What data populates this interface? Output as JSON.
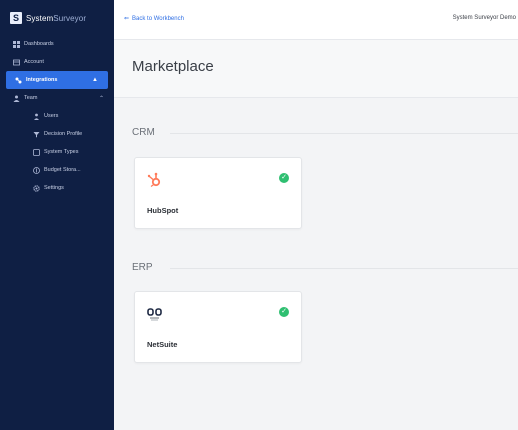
{
  "app": {
    "brand_logo": "S",
    "brand_name": "System",
    "brand_name_light": "Surveyor"
  },
  "sidebar": {
    "items": [
      {
        "label": "Dashboards",
        "icon": "dashboard-icon"
      },
      {
        "label": "Account",
        "icon": "account-icon"
      },
      {
        "label": "Integrations",
        "icon": "integrations-icon",
        "active": true
      },
      {
        "label": "Team",
        "icon": "team-icon",
        "expandable": true
      },
      {
        "label": "Users",
        "icon": "users-icon",
        "sub": true
      },
      {
        "label": "Decision Profile",
        "icon": "decision-icon",
        "sub": true
      },
      {
        "label": "System Types",
        "icon": "system-types-icon",
        "sub": true
      },
      {
        "label": "Budget Stora...",
        "icon": "budget-icon",
        "sub": true
      },
      {
        "label": "Settings",
        "icon": "settings-icon",
        "sub": true
      }
    ]
  },
  "topbar": {
    "back_label": "Back to Workbench",
    "org_name": "System Surveyor Demo"
  },
  "page": {
    "title": "Marketplace"
  },
  "sections": {
    "crm": {
      "title": "CRM",
      "card": {
        "name": "HubSpot",
        "connected": true
      }
    },
    "erp": {
      "title": "ERP",
      "card": {
        "name": "NetSuite",
        "connected": true
      }
    }
  },
  "colors": {
    "sidebar_bg": "#0f1f44",
    "accent": "#2f6fe4",
    "connected": "#2fbf71",
    "hubspot": "#ff7a59"
  }
}
